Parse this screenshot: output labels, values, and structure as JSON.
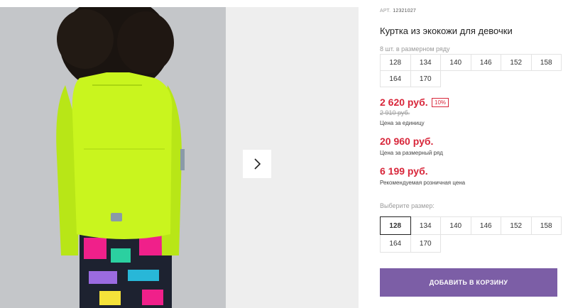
{
  "product": {
    "art_label": "АРТ.",
    "art_number": "12321027",
    "title": "Куртка из экокожи для девочки"
  },
  "size_row": {
    "note": "8 шт. в размерном ряду",
    "sizes": [
      "128",
      "134",
      "140",
      "146",
      "152",
      "158",
      "164",
      "170"
    ]
  },
  "prices": {
    "unit_price": "2 620 руб.",
    "discount": "10%",
    "old_price": "2 910 руб.",
    "unit_note": "Цена за единицу",
    "row_price": "20 960 руб.",
    "row_note": "Цена за размерный ряд",
    "retail_price": "6 199 руб.",
    "retail_note": "Рекомендуемая розничная цена"
  },
  "size_select": {
    "label": "Выберите размер:",
    "selected": "128",
    "sizes": [
      "128",
      "134",
      "140",
      "146",
      "152",
      "158",
      "164",
      "170"
    ]
  },
  "cart": {
    "add_label": "ДОБАВИТЬ В КОРЗИНУ"
  },
  "colors": {
    "price_red": "#d8263a",
    "button_purple": "#7c5ea6",
    "jacket": "#c9f51e"
  },
  "icons": {
    "next": "chevron-right-icon"
  }
}
